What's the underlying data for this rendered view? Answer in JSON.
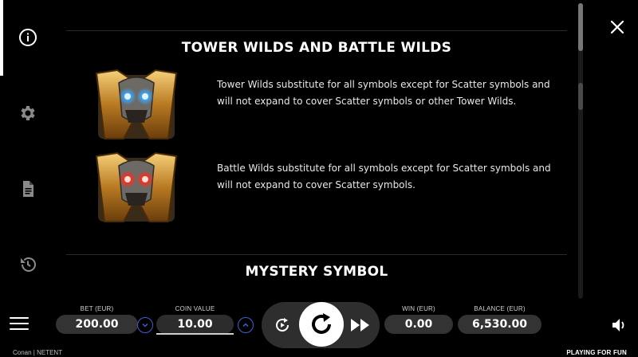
{
  "sidebar": {
    "items": [
      {
        "icon": "info-icon"
      },
      {
        "icon": "gear-icon"
      },
      {
        "icon": "document-icon"
      },
      {
        "icon": "history-icon"
      }
    ]
  },
  "content": {
    "sections": [
      {
        "title": "TOWER WILDS AND BATTLE WILDS",
        "symbols": [
          {
            "icon": "tower-wild-blue-eyes-symbol",
            "eye_color": "#3aa8ff",
            "description": "Tower Wilds substitute for all symbols except for Scatter symbols and will not expand to cover Scatter symbols or other Tower Wilds."
          },
          {
            "icon": "battle-wild-red-eyes-symbol",
            "eye_color": "#ff2a1a",
            "description": "Battle Wilds substitute for all symbols except for Scatter symbols and will not expand to cover Scatter symbols."
          }
        ]
      },
      {
        "title": "MYSTERY SYMBOL"
      }
    ]
  },
  "close": {
    "icon": "close-icon"
  },
  "bottom_bar": {
    "menu_icon": "hamburger-menu-icon",
    "bet": {
      "label": "BET (EUR)",
      "value": "200.00"
    },
    "coin_value": {
      "label": "COIN VALUE",
      "value": "10.00",
      "decrease_icon": "chevron-down-icon",
      "increase_icon": "chevron-up-icon"
    },
    "autoplay_icon": "autoplay-icon",
    "spin_icon": "spin-icon",
    "fast_forward_icon": "fast-forward-icon",
    "win": {
      "label": "WIN (EUR)",
      "value": "0.00"
    },
    "balance": {
      "label": "BALANCE (EUR)",
      "value": "6,530.00"
    },
    "sound_icon": "speaker-icon",
    "footer_left": "Conan | NETENT",
    "footer_right": "PLAYING FOR FUN"
  },
  "colors": {
    "accent_blue": "#3f5fcf",
    "pill": "#333333",
    "background": "#000000"
  }
}
